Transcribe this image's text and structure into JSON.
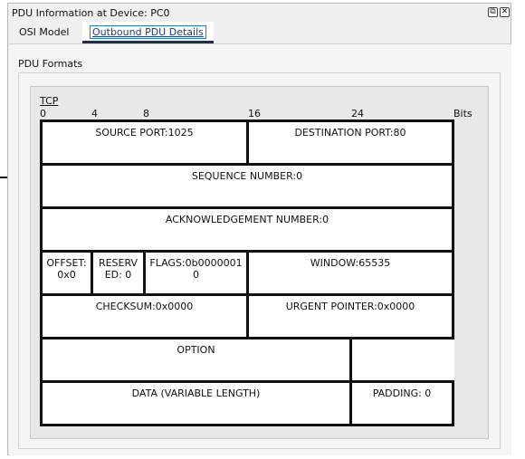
{
  "window": {
    "title": "PDU Information at Device: PC0",
    "float_icon": "⧉",
    "close_icon": "✕"
  },
  "tabs": [
    {
      "label": "OSI Model",
      "active": false
    },
    {
      "label": "Outbound PDU Details",
      "active": true
    }
  ],
  "section": {
    "label": "PDU Formats"
  },
  "pdu": {
    "protocol": "TCP",
    "ruler": {
      "b0": "0",
      "b4": "4",
      "b8": "8",
      "b16": "16",
      "b24": "24",
      "unit": "Bits"
    },
    "fields": {
      "source_port": "SOURCE PORT:1025",
      "destination_port": "DESTINATION PORT:80",
      "sequence_number": "SEQUENCE NUMBER:0",
      "ack_number": "ACKNOWLEDGEMENT NUMBER:0",
      "offset": "OFFSET: 0x0",
      "reserved": "RESERV ED: 0",
      "flags": "FLAGS:0b0000001 0",
      "window": "WINDOW:65535",
      "checksum": "CHECKSUM:0x0000",
      "urgent_pointer": "URGENT POINTER:0x0000",
      "option": "OPTION",
      "data": "DATA (VARIABLE LENGTH)",
      "padding": "PADDING: 0"
    }
  }
}
